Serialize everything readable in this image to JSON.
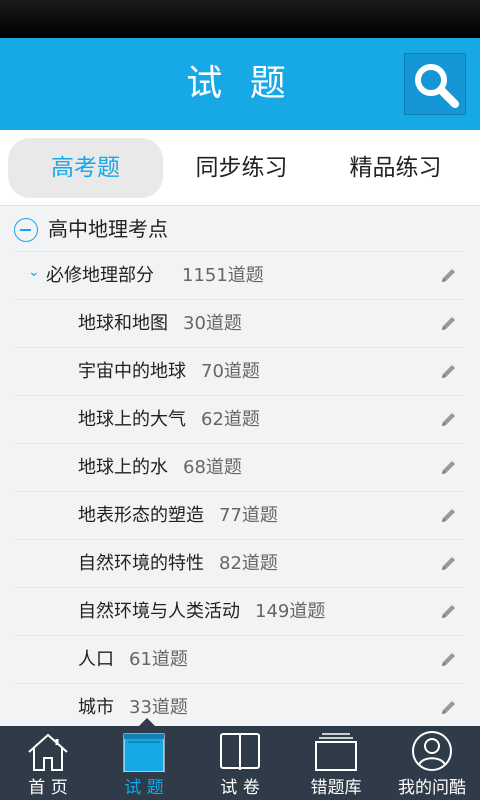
{
  "header": {
    "title": "试 题"
  },
  "tabs": [
    {
      "label": "高考题",
      "active": true
    },
    {
      "label": "同步练习",
      "active": false
    },
    {
      "label": "精品练习",
      "active": false
    }
  ],
  "tree": {
    "root": {
      "label": "高中地理考点"
    },
    "section": {
      "label": "必修地理部分",
      "count": "1151道题"
    },
    "items": [
      {
        "label": "地球和地图",
        "count": "30道题"
      },
      {
        "label": "宇宙中的地球",
        "count": "70道题"
      },
      {
        "label": "地球上的大气",
        "count": "62道题"
      },
      {
        "label": "地球上的水",
        "count": "68道题"
      },
      {
        "label": "地表形态的塑造",
        "count": "77道题"
      },
      {
        "label": "自然环境的特性",
        "count": "82道题"
      },
      {
        "label": "自然环境与人类活动",
        "count": "149道题"
      },
      {
        "label": "人口",
        "count": "61道题"
      },
      {
        "label": "城市",
        "count": "33道题"
      }
    ]
  },
  "bottom_nav": [
    {
      "label": "首 页",
      "icon": "home-icon"
    },
    {
      "label": "试 题",
      "icon": "questions-icon",
      "active": true
    },
    {
      "label": "试 卷",
      "icon": "book-icon"
    },
    {
      "label": "错题库",
      "icon": "folder-icon"
    },
    {
      "label": "我的问酷",
      "icon": "user-icon"
    }
  ],
  "colors": {
    "accent": "#17a8e6",
    "tabbar": "#2f3b49"
  }
}
